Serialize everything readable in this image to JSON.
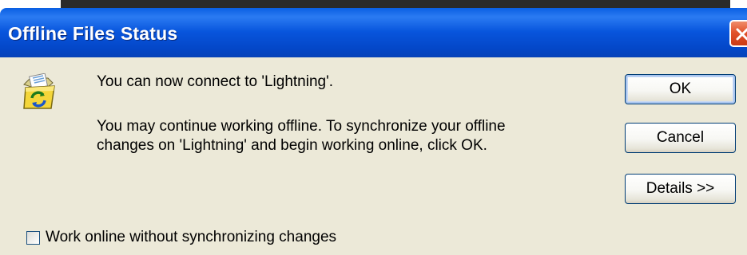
{
  "window": {
    "title": "Offline Files Status",
    "icons": {
      "app": "offline-files-sync-icon",
      "close": "close-icon"
    },
    "colors": {
      "titlebar": "#0855dd",
      "close_button": "#e2532c",
      "client_background": "#ece9d8"
    }
  },
  "message": {
    "line1": "You can now connect to 'Lightning'.",
    "line2a": "You may continue working offline.  To synchronize your offline",
    "line2b": "changes on 'Lightning' and begin working online, click OK."
  },
  "buttons": {
    "ok": "OK",
    "cancel": "Cancel",
    "details": "Details >>"
  },
  "checkbox": {
    "label": "Work online without synchronizing changes",
    "checked": false
  }
}
